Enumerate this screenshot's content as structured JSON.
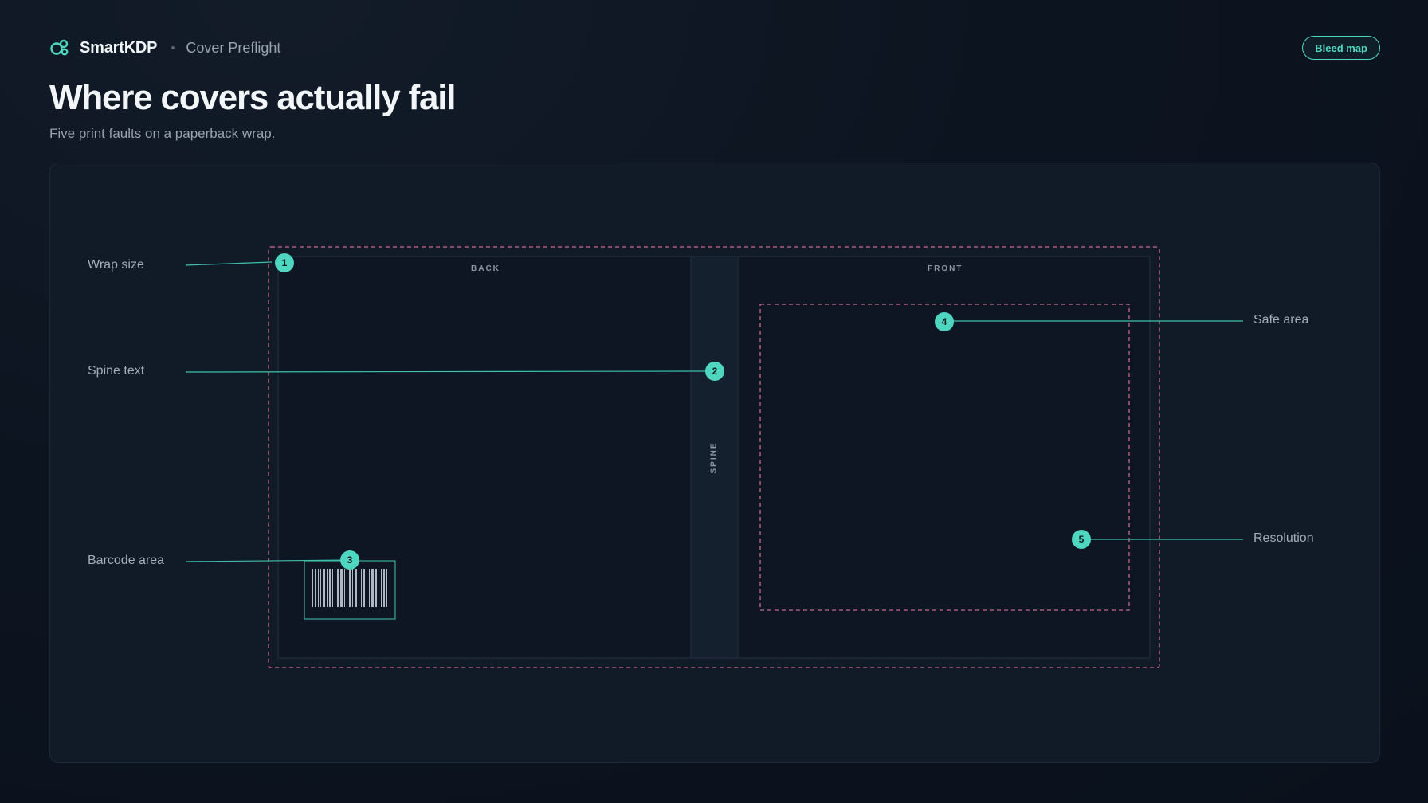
{
  "header": {
    "brand": "SmartKDP",
    "breadcrumb": "Cover Preflight",
    "bleed_button": "Bleed map"
  },
  "page": {
    "title": "Where covers actually fail",
    "subtitle": "Five print faults on a paperback wrap."
  },
  "diagram": {
    "panels": {
      "back": "BACK",
      "front": "FRONT",
      "spine": "SPINE"
    },
    "callouts": [
      {
        "number": "1",
        "label": "Wrap size"
      },
      {
        "number": "2",
        "label": "Spine text"
      },
      {
        "number": "3",
        "label": "Barcode area"
      },
      {
        "number": "4",
        "label": "Safe area"
      },
      {
        "number": "5",
        "label": "Resolution"
      }
    ]
  },
  "colors": {
    "accent": "#4fd6c0",
    "bleed_line": "#c86a8c",
    "background": "#0c1420"
  }
}
